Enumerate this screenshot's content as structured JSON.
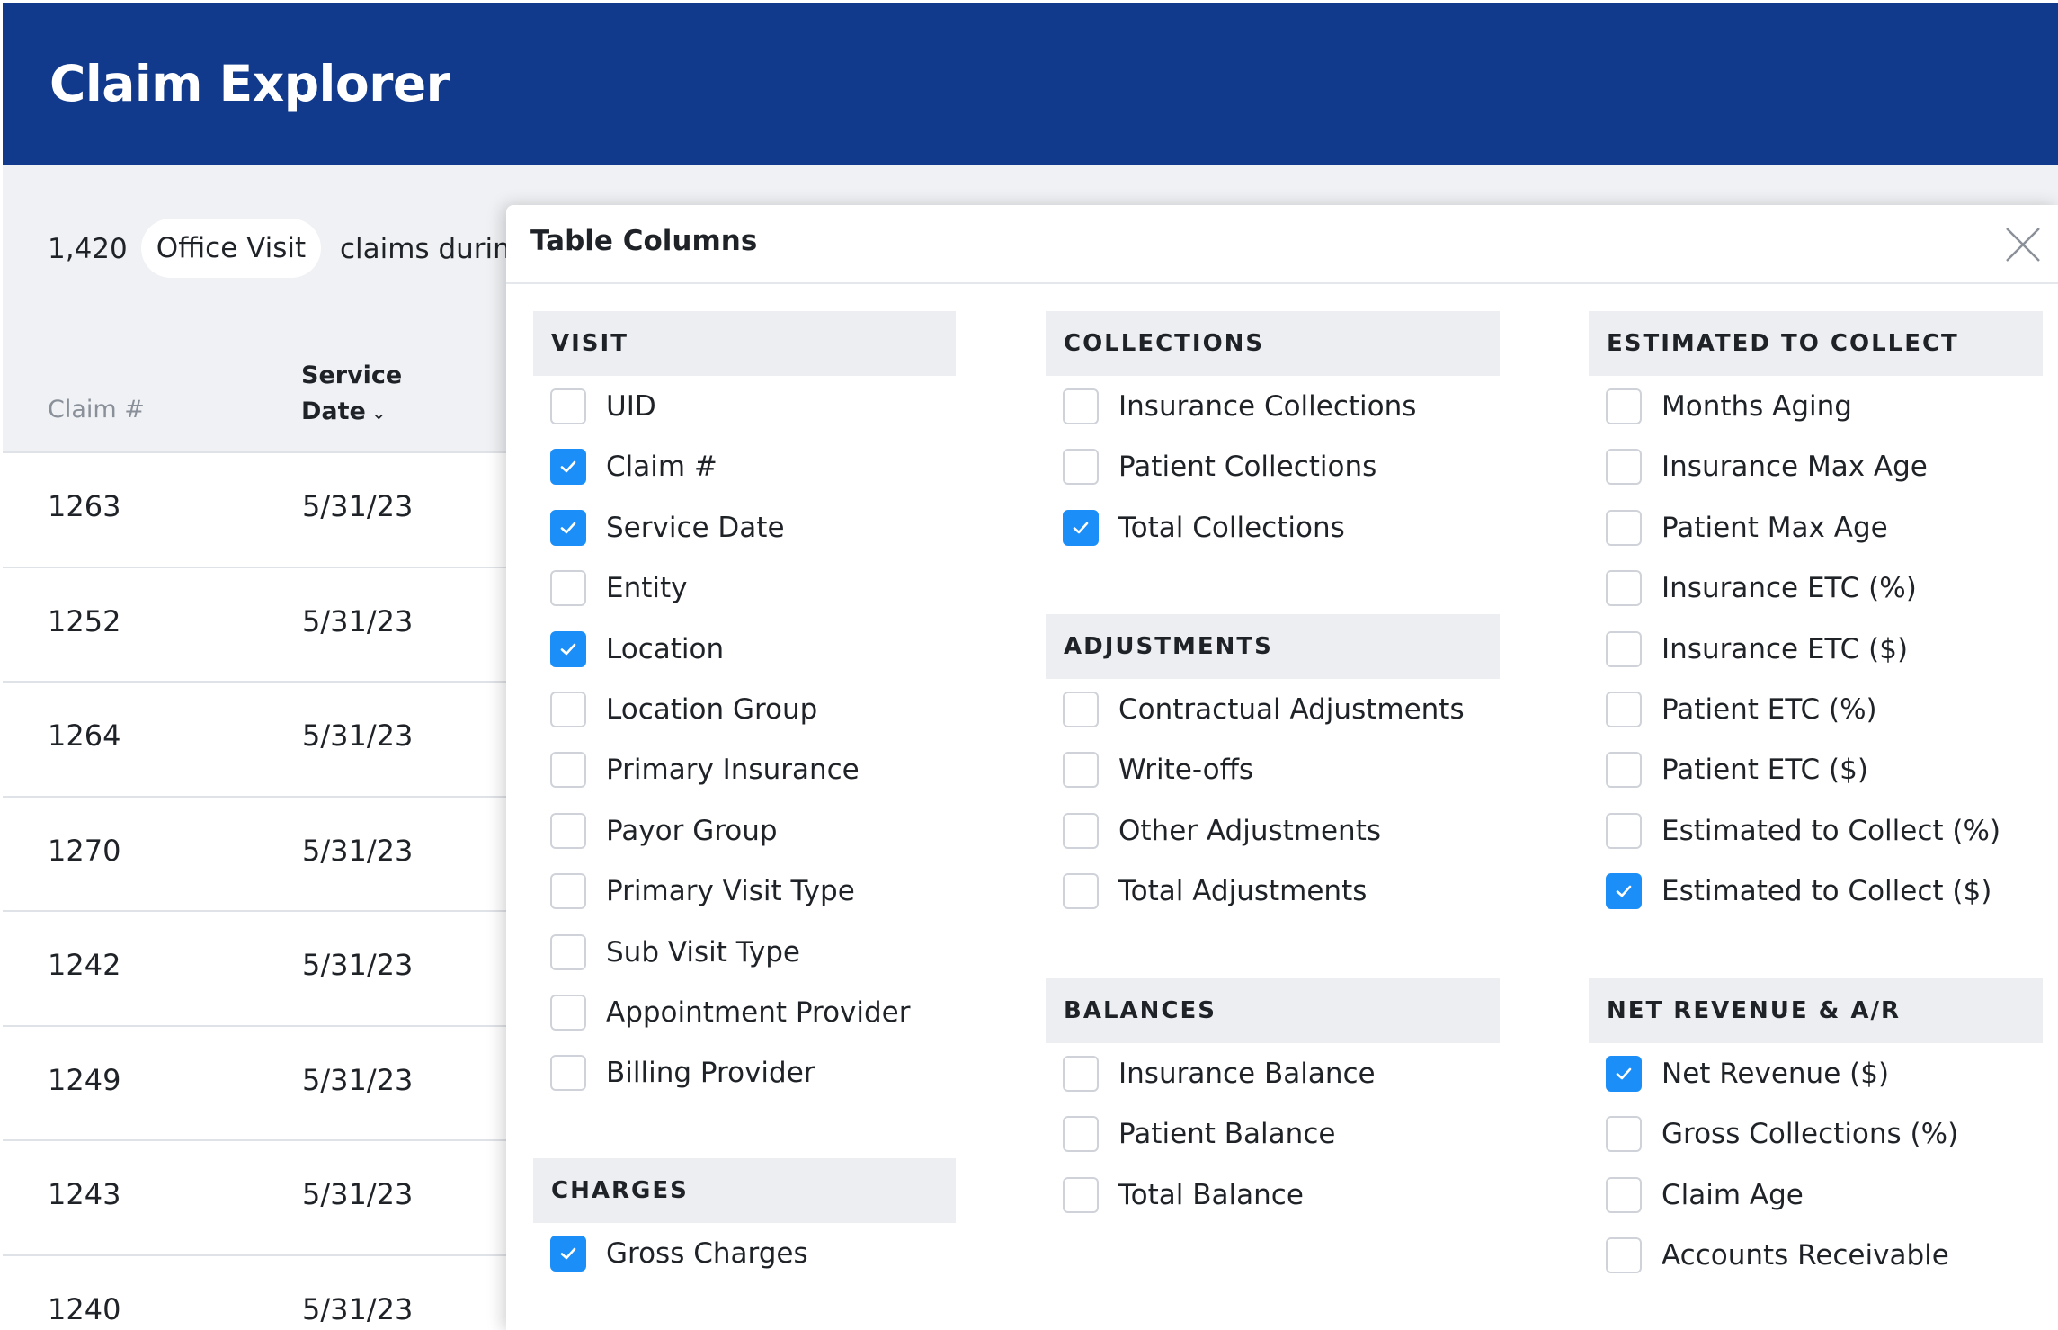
{
  "app": {
    "title": "Claim Explorer"
  },
  "summary": {
    "count": "1,420",
    "filter_pill": "Office Visit",
    "text": "claims during"
  },
  "table": {
    "columns": {
      "claim": "Claim #",
      "service_date_line1": "Service",
      "service_date_line2": "Date"
    },
    "rows": [
      {
        "id": "1263",
        "date": "5/31/23"
      },
      {
        "id": "1252",
        "date": "5/31/23"
      },
      {
        "id": "1264",
        "date": "5/31/23"
      },
      {
        "id": "1270",
        "date": "5/31/23"
      },
      {
        "id": "1242",
        "date": "5/31/23"
      },
      {
        "id": "1249",
        "date": "5/31/23"
      },
      {
        "id": "1243",
        "date": "5/31/23"
      },
      {
        "id": "1240",
        "date": "5/31/23"
      }
    ]
  },
  "modal": {
    "title": "Table Columns",
    "close_icon": "close-icon",
    "checkbox_color": "#1b8ef7",
    "sections": [
      {
        "id": "visit",
        "title": "VISIT",
        "options": [
          {
            "label": "UID",
            "checked": false
          },
          {
            "label": "Claim #",
            "checked": true
          },
          {
            "label": "Service Date",
            "checked": true
          },
          {
            "label": "Entity",
            "checked": false
          },
          {
            "label": "Location",
            "checked": true
          },
          {
            "label": "Location Group",
            "checked": false
          },
          {
            "label": "Primary Insurance",
            "checked": false
          },
          {
            "label": "Payor Group",
            "checked": false
          },
          {
            "label": "Primary Visit Type",
            "checked": false
          },
          {
            "label": "Sub Visit Type",
            "checked": false
          },
          {
            "label": "Appointment Provider",
            "checked": false
          },
          {
            "label": "Billing Provider",
            "checked": false
          }
        ]
      },
      {
        "id": "charges",
        "title": "CHARGES",
        "options": [
          {
            "label": "Gross Charges",
            "checked": true
          }
        ]
      },
      {
        "id": "collections",
        "title": "COLLECTIONS",
        "options": [
          {
            "label": "Insurance Collections",
            "checked": false
          },
          {
            "label": "Patient Collections",
            "checked": false
          },
          {
            "label": "Total Collections",
            "checked": true
          }
        ]
      },
      {
        "id": "adjustments",
        "title": "ADJUSTMENTS",
        "options": [
          {
            "label": "Contractual Adjustments",
            "checked": false
          },
          {
            "label": "Write-offs",
            "checked": false
          },
          {
            "label": "Other Adjustments",
            "checked": false
          },
          {
            "label": "Total Adjustments",
            "checked": false
          }
        ]
      },
      {
        "id": "balances",
        "title": "BALANCES",
        "options": [
          {
            "label": "Insurance Balance",
            "checked": false
          },
          {
            "label": "Patient Balance",
            "checked": false
          },
          {
            "label": "Total Balance",
            "checked": false
          }
        ]
      },
      {
        "id": "estimated-to-collect",
        "title": "ESTIMATED TO COLLECT",
        "options": [
          {
            "label": "Months Aging",
            "checked": false
          },
          {
            "label": "Insurance Max Age",
            "checked": false
          },
          {
            "label": "Patient Max Age",
            "checked": false
          },
          {
            "label": "Insurance ETC (%)",
            "checked": false
          },
          {
            "label": "Insurance ETC ($)",
            "checked": false
          },
          {
            "label": "Patient ETC (%)",
            "checked": false
          },
          {
            "label": "Patient ETC ($)",
            "checked": false
          },
          {
            "label": "Estimated to Collect (%)",
            "checked": false
          },
          {
            "label": "Estimated to Collect ($)",
            "checked": true
          }
        ]
      },
      {
        "id": "net-revenue-ar",
        "title": "NET REVENUE & A/R",
        "options": [
          {
            "label": "Net Revenue ($)",
            "checked": true
          },
          {
            "label": "Gross Collections (%)",
            "checked": false
          },
          {
            "label": "Claim Age",
            "checked": false
          },
          {
            "label": "Accounts Receivable",
            "checked": false
          }
        ]
      }
    ]
  }
}
